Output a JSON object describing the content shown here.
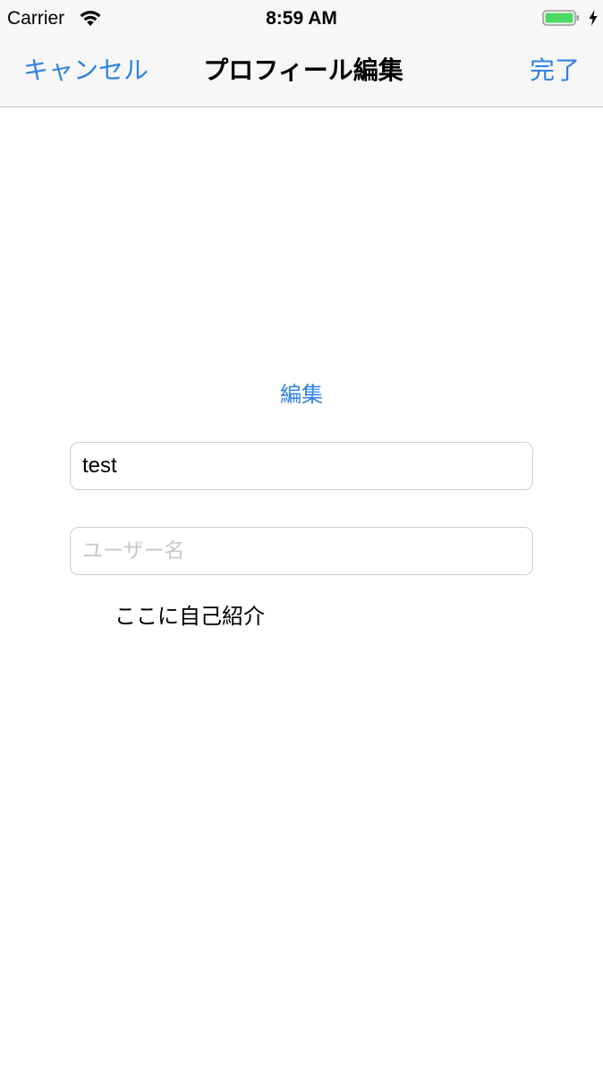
{
  "status_bar": {
    "carrier": "Carrier",
    "time": "8:59 AM",
    "icons": [
      "wifi-icon",
      "battery-icon",
      "charging-bolt-icon"
    ],
    "battery_color": "#4cd964"
  },
  "nav": {
    "cancel_label": "キャンセル",
    "title": "プロフィール編集",
    "done_label": "完了"
  },
  "form": {
    "edit_label": "編集",
    "name_value": "test",
    "username_value": "",
    "username_placeholder": "ユーザー名",
    "bio_text": "ここに自己紹介"
  },
  "colors": {
    "accent": "#2f82e0",
    "nav_background": "#f7f7f7",
    "placeholder": "#c7c7cd"
  }
}
